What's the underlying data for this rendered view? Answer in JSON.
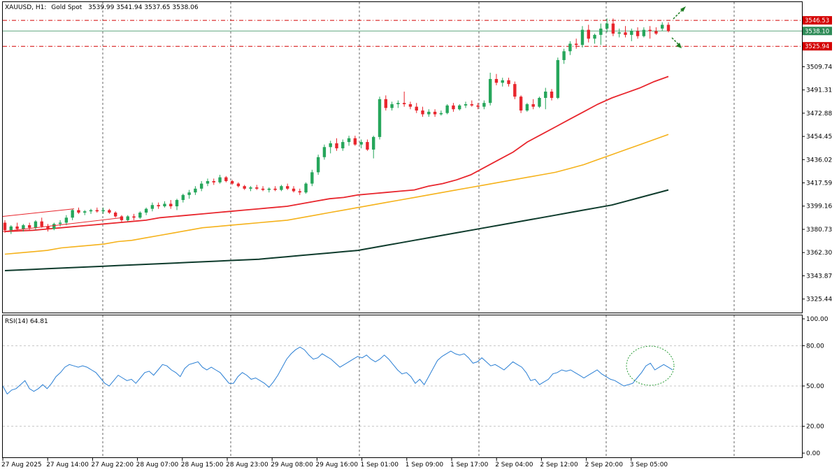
{
  "header": {
    "symbol": "XAUUSD, H1:",
    "description": "Gold Spot",
    "ohlc": "3539.99 3541.94 3537.65 3538.06"
  },
  "rsi_label": "RSI(14) 64.81",
  "colors": {
    "bull": "#26a65b",
    "bear": "#e8262d",
    "ma_fast": "#e8262d",
    "ma_mid": "#f5b21b",
    "ma_slow": "#0e3b2c",
    "rsi": "#2a7fd4",
    "price_line": "#2e8b57",
    "level": "#d40000",
    "marker": "#1e7d22"
  },
  "chart_data": [
    {
      "type": "candlestick",
      "symbol": "XAUUSD",
      "timeframe": "H1",
      "y_ticks": [
        "3509.74",
        "3491.31",
        "3472.88",
        "3454.45",
        "3436.02",
        "3417.59",
        "3399.16",
        "3380.73",
        "3362.30",
        "3343.87",
        "3325.44"
      ],
      "ylim": [
        3314.7,
        3561.0
      ],
      "x_ticks": [
        "27 Aug 2025",
        "27 Aug 14:00",
        "27 Aug 22:00",
        "28 Aug 07:00",
        "28 Aug 15:00",
        "28 Aug 23:00",
        "29 Aug 08:00",
        "29 Aug 16:00",
        "1 Sep 01:00",
        "1 Sep 09:00",
        "1 Sep 17:00",
        "2 Sep 04:00",
        "2 Sep 12:00",
        "2 Sep 20:00",
        "3 Sep 05:00"
      ],
      "candles": [
        [
          3386,
          3388,
          3378,
          3380
        ],
        [
          3380,
          3384,
          3377,
          3383
        ],
        [
          3383,
          3386,
          3379,
          3381
        ],
        [
          3381,
          3385,
          3379,
          3384
        ],
        [
          3384,
          3386,
          3380,
          3382
        ],
        [
          3382,
          3388,
          3380,
          3387
        ],
        [
          3387,
          3390,
          3382,
          3383
        ],
        [
          3383,
          3385,
          3379,
          3381
        ],
        [
          3381,
          3386,
          3380,
          3385
        ],
        [
          3385,
          3388,
          3383,
          3386
        ],
        [
          3386,
          3392,
          3384,
          3390
        ],
        [
          3390,
          3397,
          3388,
          3396
        ],
        [
          3396,
          3398,
          3393,
          3394
        ],
        [
          3394,
          3396,
          3392,
          3395
        ],
        [
          3395,
          3397,
          3393,
          3396
        ],
        [
          3396,
          3398,
          3394,
          3395
        ],
        [
          3395,
          3398,
          3393,
          3396
        ],
        [
          3396,
          3397,
          3393,
          3394
        ],
        [
          3394,
          3395,
          3390,
          3391
        ],
        [
          3391,
          3392,
          3386,
          3388
        ],
        [
          3388,
          3392,
          3387,
          3391
        ],
        [
          3391,
          3393,
          3388,
          3390
        ],
        [
          3390,
          3395,
          3389,
          3394
        ],
        [
          3394,
          3398,
          3392,
          3397
        ],
        [
          3397,
          3402,
          3395,
          3400
        ],
        [
          3400,
          3402,
          3397,
          3399
        ],
        [
          3399,
          3403,
          3398,
          3401
        ],
        [
          3401,
          3404,
          3397,
          3399
        ],
        [
          3399,
          3405,
          3396,
          3404
        ],
        [
          3404,
          3409,
          3402,
          3408
        ],
        [
          3408,
          3412,
          3405,
          3410
        ],
        [
          3410,
          3415,
          3408,
          3413
        ],
        [
          3413,
          3419,
          3411,
          3417
        ],
        [
          3417,
          3421,
          3415,
          3419
        ],
        [
          3419,
          3421,
          3416,
          3418
        ],
        [
          3418,
          3424,
          3417,
          3422
        ],
        [
          3422,
          3423,
          3418,
          3419
        ],
        [
          3419,
          3420,
          3416,
          3417
        ],
        [
          3417,
          3418,
          3414,
          3415
        ],
        [
          3415,
          3416,
          3412,
          3413
        ],
        [
          3413,
          3415,
          3411,
          3414
        ],
        [
          3414,
          3416,
          3412,
          3413
        ],
        [
          3413,
          3415,
          3411,
          3412
        ],
        [
          3412,
          3414,
          3410,
          3413
        ],
        [
          3413,
          3415,
          3411,
          3412
        ],
        [
          3412,
          3416,
          3411,
          3415
        ],
        [
          3415,
          3417,
          3412,
          3413
        ],
        [
          3413,
          3415,
          3410,
          3411
        ],
        [
          3411,
          3413,
          3408,
          3410
        ],
        [
          3410,
          3418,
          3409,
          3417
        ],
        [
          3417,
          3428,
          3415,
          3426
        ],
        [
          3426,
          3440,
          3424,
          3438
        ],
        [
          3438,
          3448,
          3436,
          3446
        ],
        [
          3446,
          3451,
          3441,
          3449
        ],
        [
          3449,
          3453,
          3443,
          3445
        ],
        [
          3445,
          3452,
          3443,
          3450
        ],
        [
          3450,
          3455,
          3447,
          3453
        ],
        [
          3453,
          3455,
          3447,
          3448
        ],
        [
          3448,
          3452,
          3445,
          3450
        ],
        [
          3450,
          3452,
          3443,
          3444
        ],
        [
          3444,
          3455,
          3437,
          3454
        ],
        [
          3454,
          3486,
          3452,
          3484
        ],
        [
          3484,
          3487,
          3475,
          3477
        ],
        [
          3477,
          3482,
          3475,
          3480
        ],
        [
          3480,
          3483,
          3477,
          3481
        ],
        [
          3481,
          3490,
          3478,
          3480
        ],
        [
          3480,
          3482,
          3476,
          3478
        ],
        [
          3478,
          3481,
          3473,
          3475
        ],
        [
          3475,
          3478,
          3470,
          3472
        ],
        [
          3472,
          3476,
          3470,
          3474
        ],
        [
          3474,
          3476,
          3470,
          3472
        ],
        [
          3472,
          3475,
          3471,
          3473
        ],
        [
          3473,
          3480,
          3472,
          3479
        ],
        [
          3479,
          3481,
          3474,
          3476
        ],
        [
          3476,
          3480,
          3475,
          3479
        ],
        [
          3479,
          3482,
          3477,
          3480
        ],
        [
          3480,
          3483,
          3478,
          3479
        ],
        [
          3479,
          3481,
          3476,
          3478
        ],
        [
          3478,
          3483,
          3476,
          3481
        ],
        [
          3481,
          3505,
          3479,
          3500
        ],
        [
          3500,
          3504,
          3495,
          3497
        ],
        [
          3497,
          3501,
          3494,
          3499
        ],
        [
          3499,
          3501,
          3494,
          3496
        ],
        [
          3496,
          3498,
          3484,
          3486
        ],
        [
          3486,
          3487,
          3473,
          3475
        ],
        [
          3475,
          3481,
          3474,
          3480
        ],
        [
          3480,
          3484,
          3476,
          3478
        ],
        [
          3478,
          3486,
          3477,
          3485
        ],
        [
          3485,
          3493,
          3476,
          3490
        ],
        [
          3490,
          3492,
          3483,
          3485
        ],
        [
          3485,
          3517,
          3484,
          3515
        ],
        [
          3515,
          3524,
          3512,
          3522
        ],
        [
          3522,
          3530,
          3519,
          3528
        ],
        [
          3528,
          3532,
          3524,
          3527
        ],
        [
          3527,
          3542,
          3525,
          3539
        ],
        [
          3539,
          3543,
          3529,
          3532
        ],
        [
          3532,
          3536,
          3528,
          3535
        ],
        [
          3535,
          3544,
          3527,
          3540
        ],
        [
          3540,
          3548,
          3537,
          3544
        ],
        [
          3544,
          3548,
          3534,
          3536
        ],
        [
          3536,
          3540,
          3533,
          3537
        ],
        [
          3537,
          3542,
          3533,
          3535
        ],
        [
          3535,
          3540,
          3530,
          3538
        ],
        [
          3538,
          3541,
          3532,
          3534
        ],
        [
          3534,
          3541,
          3533,
          3539
        ],
        [
          3539,
          3542,
          3532,
          3538
        ],
        [
          3538,
          3541,
          3535,
          3536
        ],
        [
          3540,
          3545,
          3538,
          3543
        ],
        [
          3543,
          3545,
          3537,
          3538
        ]
      ],
      "ma_fast": [
        3379,
        3379.5,
        3380,
        3381,
        3382,
        3383,
        3384,
        3385,
        3386,
        3387,
        3388,
        3390,
        3391,
        3392,
        3393,
        3394,
        3395,
        3396,
        3397,
        3398,
        3399,
        3401,
        3403,
        3405,
        3406,
        3408,
        3409,
        3410,
        3411,
        3412,
        3415,
        3417,
        3420,
        3424,
        3430,
        3436,
        3442,
        3450,
        3456,
        3462,
        3468,
        3474,
        3480,
        3485,
        3489,
        3493,
        3498,
        3502
      ],
      "ma_mid": [
        3361,
        3362,
        3363,
        3364,
        3366,
        3367,
        3368,
        3369,
        3371,
        3372,
        3374,
        3376,
        3378,
        3380,
        3382,
        3383,
        3384,
        3385,
        3386,
        3387,
        3388,
        3390,
        3392,
        3394,
        3396,
        3398,
        3400,
        3402,
        3404,
        3406,
        3408,
        3410,
        3412,
        3414,
        3416,
        3418,
        3420,
        3422,
        3424,
        3426,
        3429,
        3432,
        3436,
        3440,
        3444,
        3448,
        3452,
        3456
      ],
      "ma_slow": [
        3348,
        3348.5,
        3349,
        3349.5,
        3350,
        3350.5,
        3351,
        3351.5,
        3352,
        3352.5,
        3353,
        3353.5,
        3354,
        3354.5,
        3355,
        3355.5,
        3356,
        3356.5,
        3357,
        3358,
        3359,
        3360,
        3361,
        3362,
        3363,
        3364,
        3366,
        3368,
        3370,
        3372,
        3374,
        3376,
        3378,
        3380,
        3382,
        3384,
        3386,
        3388,
        3390,
        3392,
        3394,
        3396,
        3398,
        3400,
        3403,
        3406,
        3409,
        3412
      ],
      "trendline": {
        "from": [
          3391,
          3397
        ],
        "to": [
          3379,
          3384
        ]
      },
      "price_tags": [
        "3546.53",
        "3538.10",
        "3525.94"
      ],
      "levels": [
        3546.53,
        3538.1,
        3525.94
      ]
    },
    {
      "type": "line",
      "name": "RSI(14)",
      "y_ticks": [
        "100.00",
        "80.00",
        "50.00",
        "20.00",
        "0.00"
      ],
      "ylim": [
        0,
        100
      ],
      "levels": [
        80,
        50,
        20
      ],
      "values": [
        50,
        44,
        47,
        48,
        51,
        54,
        48,
        46,
        48,
        51,
        48,
        52,
        57,
        60,
        64,
        66,
        65,
        64,
        65,
        64,
        62,
        60,
        56,
        52,
        50,
        54,
        58,
        56,
        54,
        55,
        52,
        56,
        60,
        61,
        58,
        62,
        66,
        65,
        62,
        60,
        57,
        63,
        66,
        67,
        68,
        64,
        62,
        64,
        62,
        60,
        56,
        52,
        52,
        57,
        60,
        58,
        55,
        56,
        54,
        52,
        49,
        53,
        58,
        64,
        70,
        74,
        77,
        79,
        77,
        73,
        70,
        71,
        74,
        72,
        70,
        67,
        64,
        66,
        68,
        70,
        72,
        71,
        73,
        70,
        68,
        70,
        73,
        70,
        66,
        62,
        59,
        60,
        57,
        52,
        55,
        51,
        57,
        63,
        69,
        72,
        74,
        76,
        74,
        73,
        74,
        71,
        67,
        68,
        71,
        68,
        65,
        66,
        64,
        62,
        65,
        68,
        66,
        64,
        60,
        54,
        55,
        51,
        53,
        55,
        59,
        60,
        62,
        61,
        62,
        60,
        58,
        56,
        58,
        60,
        62,
        59,
        57,
        55,
        54,
        52,
        50,
        51,
        52,
        56,
        60,
        65,
        67,
        62,
        64,
        66,
        64,
        62
      ]
    }
  ]
}
